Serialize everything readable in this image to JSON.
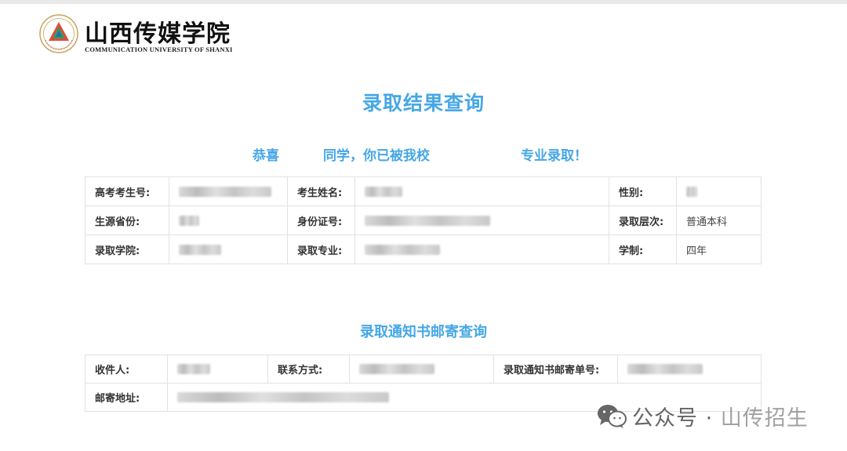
{
  "header": {
    "brand_cn": "山西传媒学院",
    "brand_en": "COMMUNICATION UNIVERSITY OF SHANXI"
  },
  "page_title": "录取结果查询",
  "congrats": {
    "part1": "恭喜",
    "part2": "同学，你已被我校",
    "part3": "专业录取！"
  },
  "admission_table": {
    "labels": {
      "exam_no": "高考考生号:",
      "name": "考生姓名:",
      "gender": "性别:",
      "province": "生源省份:",
      "id_no": "身份证号:",
      "level": "录取层次:",
      "college": "录取学院:",
      "major": "录取专业:",
      "duration": "学制:"
    },
    "values": {
      "level": "普通本科",
      "duration": "四年"
    }
  },
  "mail_section_title": "录取通知书邮寄查询",
  "mail_table": {
    "labels": {
      "recipient": "收件人:",
      "contact": "联系方式:",
      "tracking_no": "录取通知书邮寄单号:",
      "address": "邮寄地址:"
    }
  },
  "watermark": {
    "text_a": "公众号 · ",
    "text_b": "山传招生",
    "icon": "wechat-icon"
  },
  "colors": {
    "accent": "#45a7e6",
    "border": "#e2e2e2"
  }
}
